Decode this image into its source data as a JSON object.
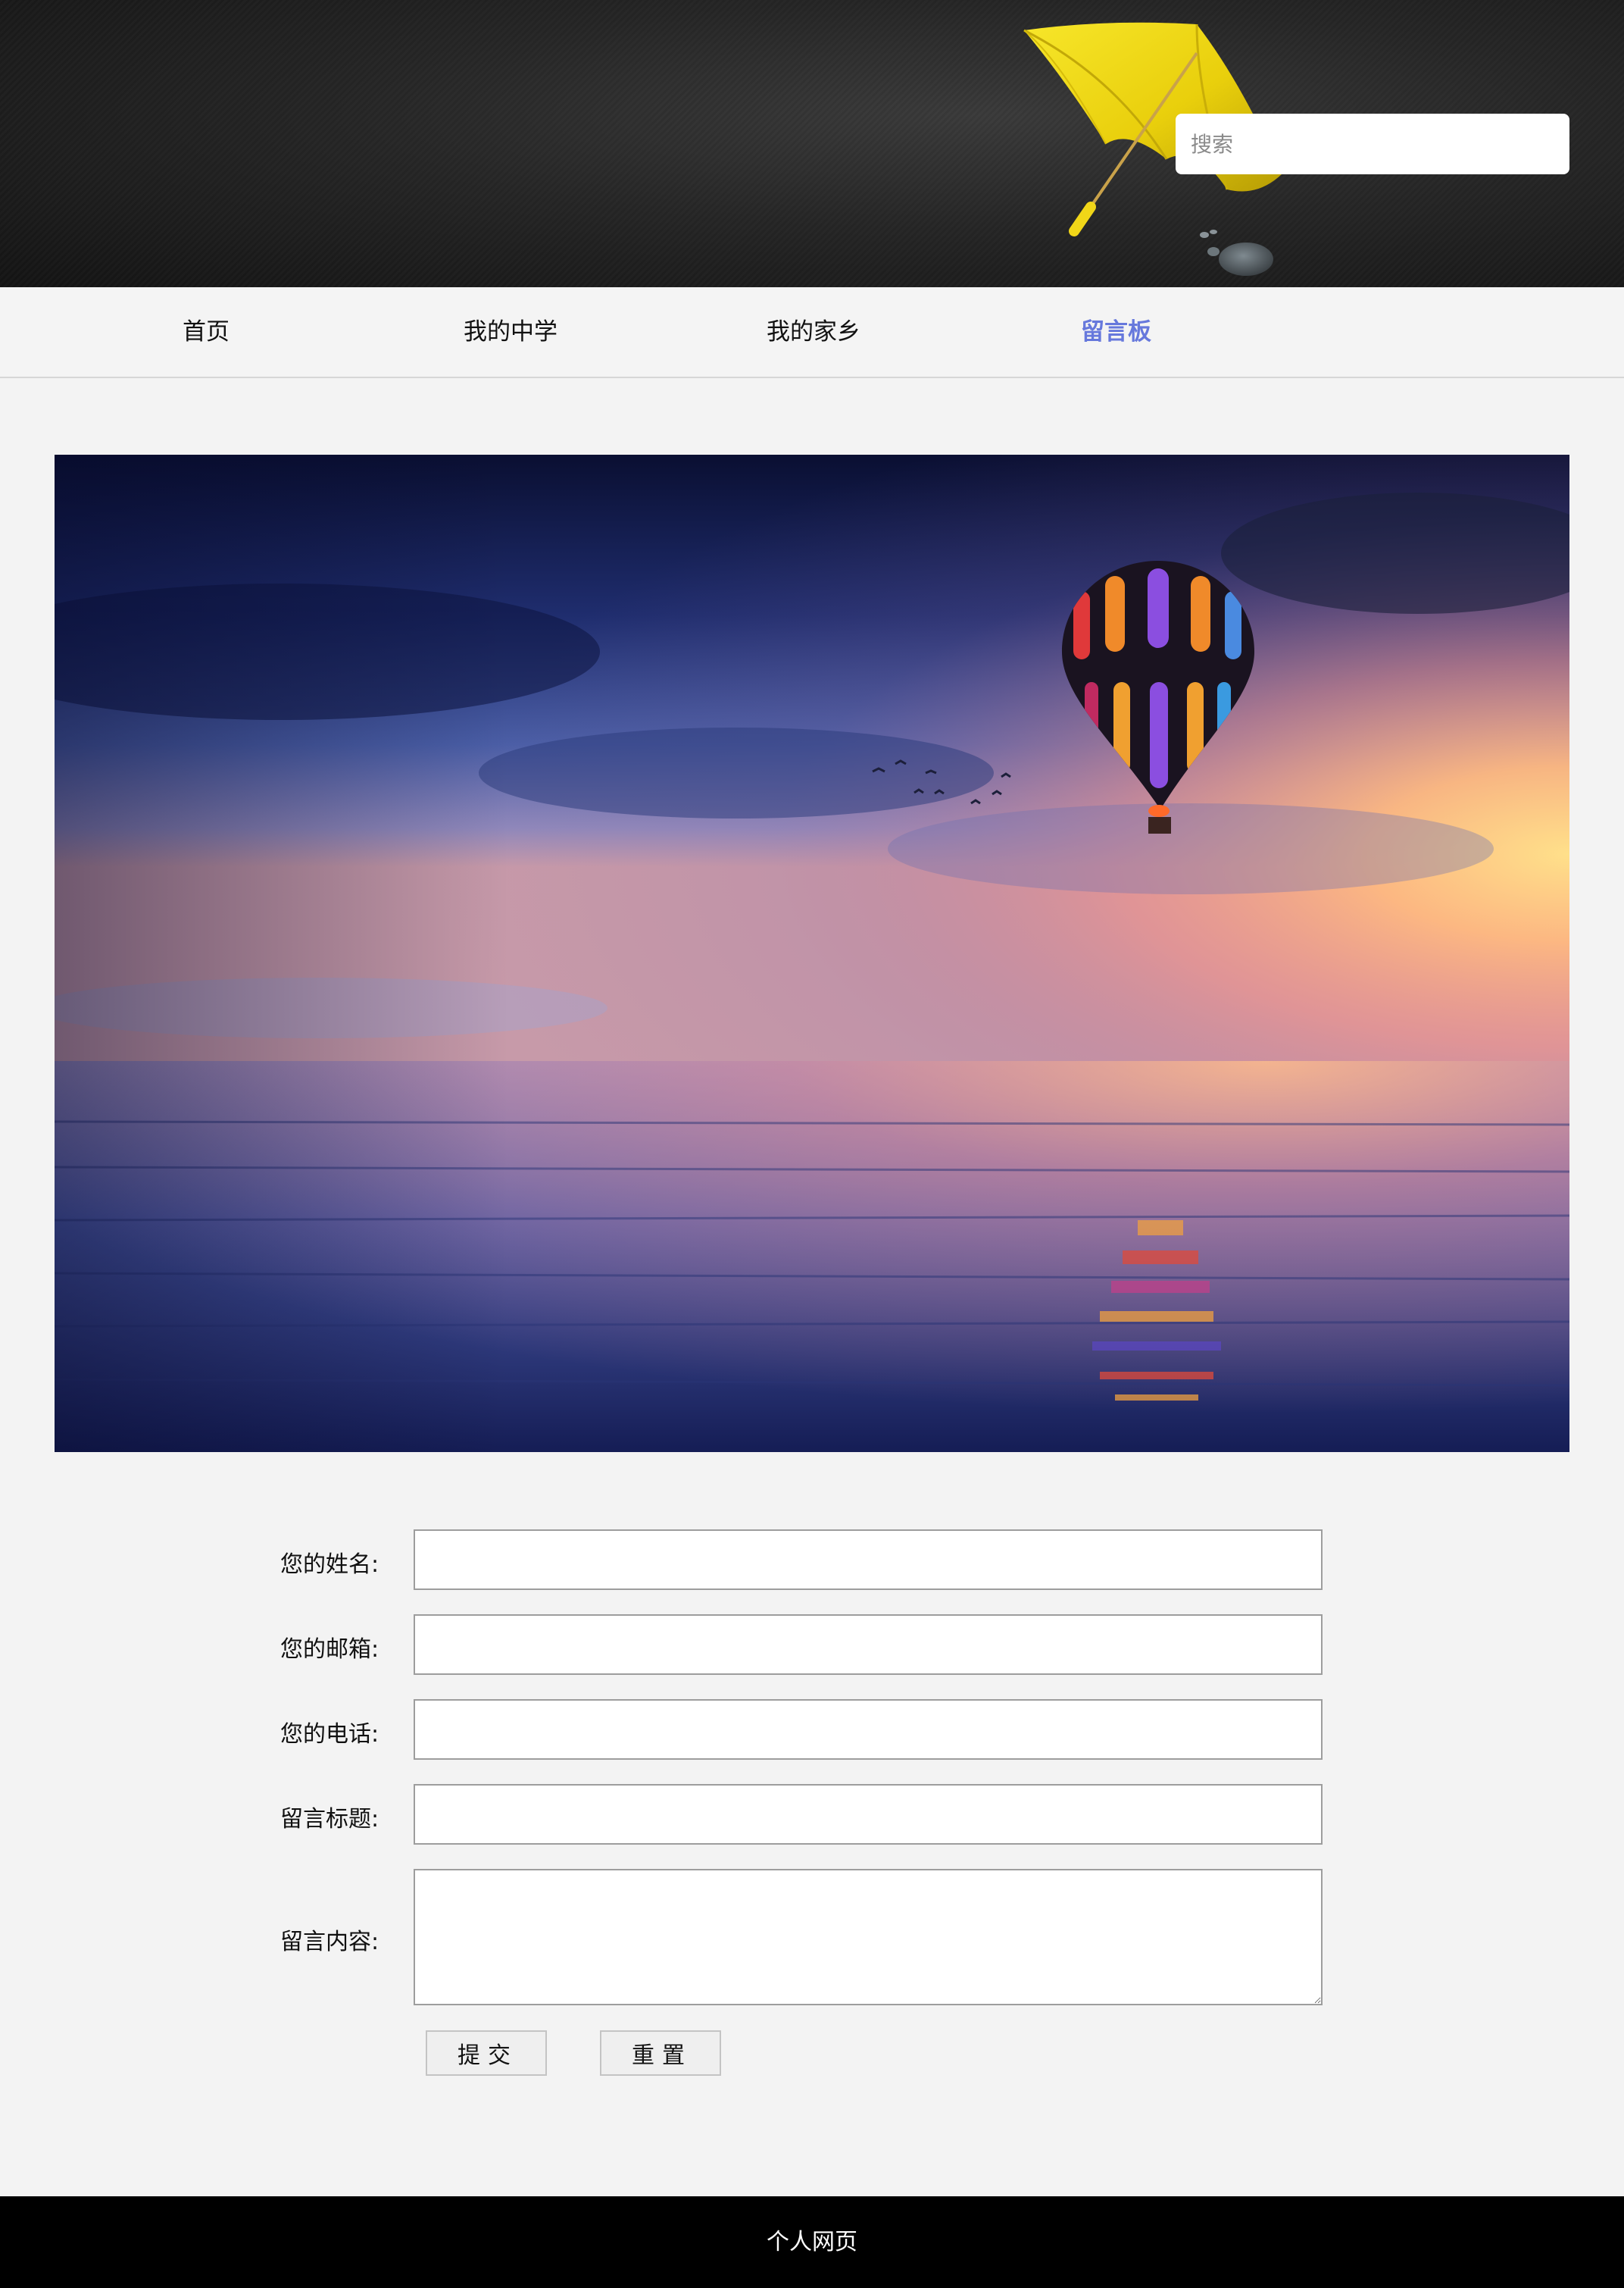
{
  "header": {
    "search_placeholder": "搜索",
    "decor_icon": "umbrella-icon"
  },
  "nav": {
    "items": [
      {
        "label": "首页",
        "active": false
      },
      {
        "label": "我的中学",
        "active": false
      },
      {
        "label": "我的家乡",
        "active": false
      },
      {
        "label": "留言板",
        "active": true
      }
    ],
    "active_color": "#6678dc"
  },
  "hero": {
    "subject": "hot-air-balloon-over-sea-at-sunset"
  },
  "form": {
    "fields": [
      {
        "label": "您的姓名:",
        "value": ""
      },
      {
        "label": "您的邮箱:",
        "value": ""
      },
      {
        "label": "您的电话:",
        "value": ""
      },
      {
        "label": "留言标题:",
        "value": ""
      },
      {
        "label": "留言内容:",
        "value": ""
      }
    ],
    "submit_label": "提交",
    "reset_label": "重置"
  },
  "footer": {
    "text": "个人网页"
  }
}
